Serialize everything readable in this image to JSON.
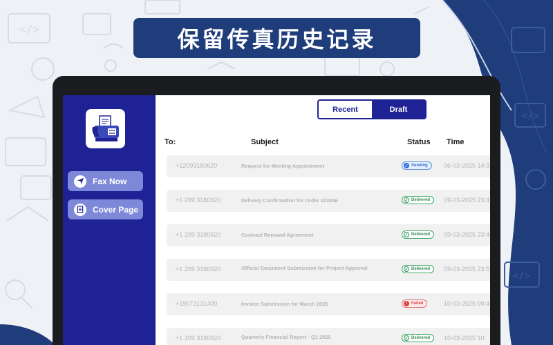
{
  "banner": {
    "title": "保留传真历史记录"
  },
  "sidebar": {
    "logo_icon": "fax-machine-icon",
    "buttons": [
      {
        "label": "Fax Now",
        "icon": "send-icon"
      },
      {
        "label": "Cover Page",
        "icon": "document-icon"
      }
    ]
  },
  "tabs": {
    "recent": "Recent",
    "draft": "Draft",
    "selected": "Draft"
  },
  "table": {
    "headers": {
      "to": "To:",
      "subject": "Subject",
      "status": "Status",
      "time": "Time"
    },
    "rows": [
      {
        "to": "+12093180620",
        "subject": "Request for Meeting Appointment",
        "status": "Sending",
        "time": "06-03-2025 14:3"
      },
      {
        "to": "+1 209 3180620",
        "subject": "Delivery Confirmation for Order #23456",
        "status": "Delivered",
        "time": "09-03-2025 23:4"
      },
      {
        "to": "+1 209 3180620",
        "subject": "Contract Renewal Agreement",
        "status": "Delivered",
        "time": "09-03-2025 23:4"
      },
      {
        "to": "+1 209 3180620",
        "subject": "Official Document Submission for Project Approval",
        "status": "Delivered",
        "time": "09-03-2025 23:5"
      },
      {
        "to": "+19073131400",
        "subject": "Invoice Submission for March 2025",
        "status": "Failed",
        "time": "10-03-2025 09:4"
      },
      {
        "to": "+1 209 3180620",
        "subject": "Quarterly Financial Report - Q1 2025",
        "status": "Delivered",
        "time": "10-03-2025 10:"
      }
    ]
  },
  "colors": {
    "banner_bg": "#1f3d7a",
    "sidebar_bg": "#1e2295",
    "sidebar_button_bg": "#7d88d8",
    "sending": "#2f6fd6",
    "delivered": "#2b8a4b",
    "failed": "#d94040"
  }
}
